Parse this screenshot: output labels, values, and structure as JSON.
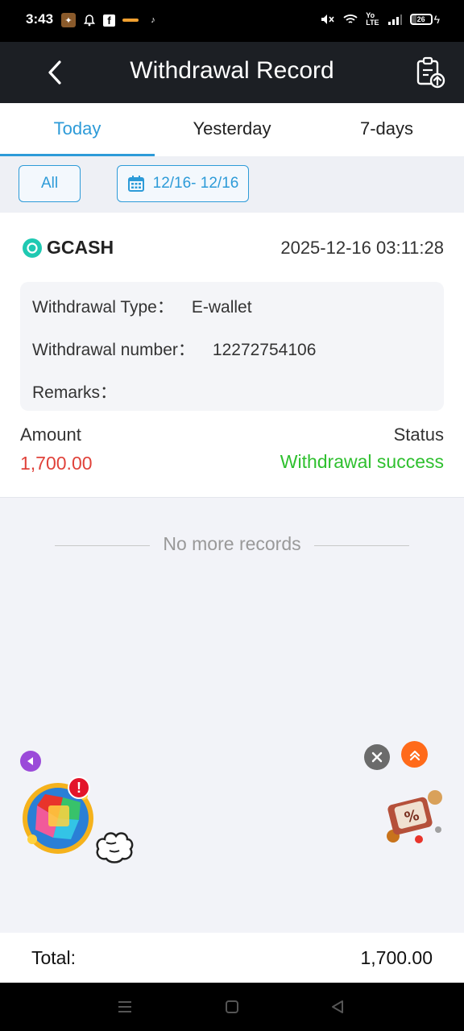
{
  "status_bar": {
    "time": "3:43",
    "battery": "26",
    "apps": [
      "game-icon",
      "bell-icon",
      "facebook-icon",
      "app-icon",
      "tiktok-icon"
    ]
  },
  "header": {
    "title": "Withdrawal Record",
    "back_icon": "chevron-left-icon",
    "record_icon": "clipboard-upload-icon"
  },
  "tabs": [
    {
      "label": "Today",
      "active": true
    },
    {
      "label": "Yesterday",
      "active": false
    },
    {
      "label": "7-days",
      "active": false
    }
  ],
  "filters": {
    "all_label": "All",
    "date_range": "12/16- 12/16"
  },
  "record": {
    "method": "GCASH",
    "datetime": "2025-12-16 03:11:28",
    "type_label": "Withdrawal Type：",
    "type_value": "E-wallet",
    "number_label": "Withdrawal number：",
    "number_value": "12272754106",
    "remarks_label": "Remarks：",
    "amount_label": "Amount",
    "amount_value": "1,700.00",
    "status_label": "Status",
    "status_value": "Withdrawal success"
  },
  "list_end_text": "No more records",
  "total": {
    "label": "Total:",
    "value": "1,700.00"
  },
  "colors": {
    "accent": "#2d9bd8",
    "amount": "#e0423a",
    "success": "#2fc02f",
    "header_bg": "#1c1f24"
  }
}
